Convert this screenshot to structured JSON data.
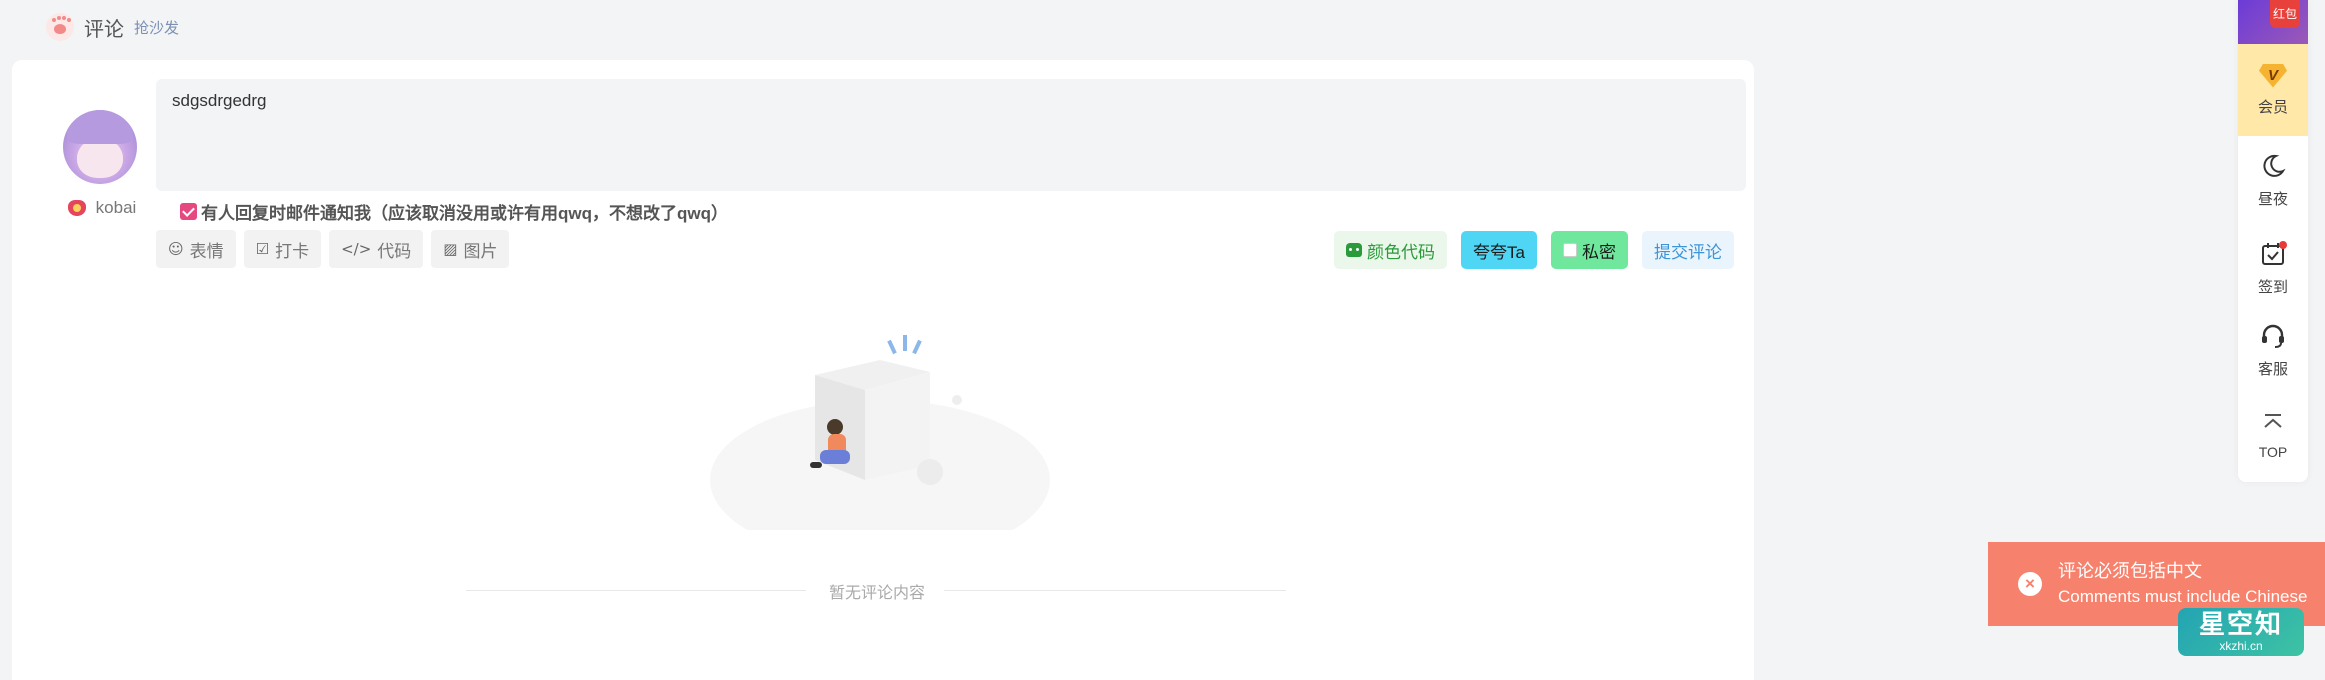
{
  "section": {
    "title": "评论",
    "subtitle": "抢沙发"
  },
  "user": {
    "name": "kobai"
  },
  "comment": {
    "value": "sdgsdrgedrg",
    "notify_label": "有人回复时邮件通知我（应该取消没用或许有用qwq，不想改了qwq）",
    "notify_checked": true
  },
  "tools": [
    {
      "icon": "smile-icon",
      "glyph": "☺",
      "label": "表情"
    },
    {
      "icon": "checkbox-icon",
      "glyph": "☑",
      "label": "打卡"
    },
    {
      "icon": "code-icon",
      "glyph": "</>",
      "label": "代码"
    },
    {
      "icon": "image-icon",
      "glyph": "▨",
      "label": "图片"
    }
  ],
  "actions": {
    "color_code": "颜色代码",
    "praise": "夸夸Ta",
    "private": "私密",
    "submit": "提交评论"
  },
  "empty": {
    "text": "暂无评论内容"
  },
  "sidebar": {
    "redpacket": "红包",
    "vip_badge": "V",
    "vip": "会员",
    "night": "昼夜",
    "checkin": "签到",
    "service": "客服",
    "top": "TOP"
  },
  "toast": {
    "line1": "评论必须包括中文",
    "line2": "Comments must include Chinese"
  },
  "watermark": {
    "main": "星空知",
    "sub": "xkzhi.cn"
  },
  "colors": {
    "toast_bg": "#f6816c",
    "checkbox": "#e64980",
    "praise_bg": "#4fd6f5",
    "private_bg": "#6fe89e",
    "submit_text": "#3d95d6",
    "vip_bg": "#ffe8a8"
  }
}
